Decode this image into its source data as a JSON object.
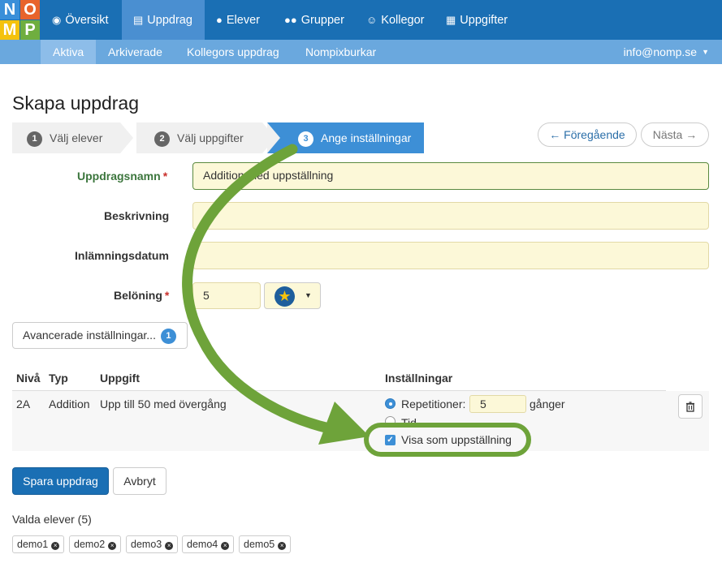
{
  "logo": {
    "letters": [
      "N",
      "O",
      "M",
      "P"
    ]
  },
  "topnav": {
    "items": [
      {
        "label": "Översikt",
        "icon": "dashboard-icon"
      },
      {
        "label": "Uppdrag",
        "icon": "book-icon",
        "active": true
      },
      {
        "label": "Elever",
        "icon": "user-icon"
      },
      {
        "label": "Grupper",
        "icon": "users-icon"
      },
      {
        "label": "Kollegor",
        "icon": "smile-icon"
      },
      {
        "label": "Uppgifter",
        "icon": "grid-icon"
      }
    ]
  },
  "subnav": {
    "items": [
      {
        "label": "Aktiva",
        "active": true
      },
      {
        "label": "Arkiverade"
      },
      {
        "label": "Kollegors uppdrag"
      },
      {
        "label": "Nompixburkar"
      }
    ],
    "account": "info@nomp.se"
  },
  "page_title": "Skapa uppdrag",
  "wizard": {
    "steps": [
      {
        "num": "1",
        "label": "Välj elever"
      },
      {
        "num": "2",
        "label": "Välj uppgifter"
      },
      {
        "num": "3",
        "label": "Ange inställningar",
        "active": true
      }
    ],
    "prev": "← Föregående",
    "next": "Nästa →"
  },
  "form": {
    "name_label": "Uppdragsnamn",
    "name_value": "Addition med uppställning",
    "description_label": "Beskrivning",
    "description_value": "",
    "date_label": "Inlämningsdatum",
    "date_value": "",
    "reward_label": "Belöning",
    "reward_value": "5",
    "required_mark": "*",
    "advanced_label": "Avancerade inställningar...",
    "advanced_count": "1"
  },
  "table": {
    "headers": [
      "Nivå",
      "Typ",
      "Uppgift",
      "Inställningar"
    ],
    "rows": [
      {
        "level": "2A",
        "type": "Addition",
        "task": "Upp till 50 med övergång",
        "repetitions_label": "Repetitioner:",
        "repetitions_value": "5",
        "repetitions_unit": "gånger",
        "second_option_partial": "Tid",
        "checkbox_label": "Visa som uppställning",
        "checkbox_checked": true
      }
    ]
  },
  "actions": {
    "save": "Spara uppdrag",
    "cancel": "Avbryt"
  },
  "selected": {
    "title": "Valda elever (5)",
    "students": [
      "demo1",
      "demo2",
      "demo3",
      "demo4",
      "demo5"
    ]
  },
  "colors": {
    "primary": "#1a6fb4",
    "subnav": "#6aa8de",
    "input_bg": "#fcf8d8",
    "highlight": "#6ea33a"
  }
}
